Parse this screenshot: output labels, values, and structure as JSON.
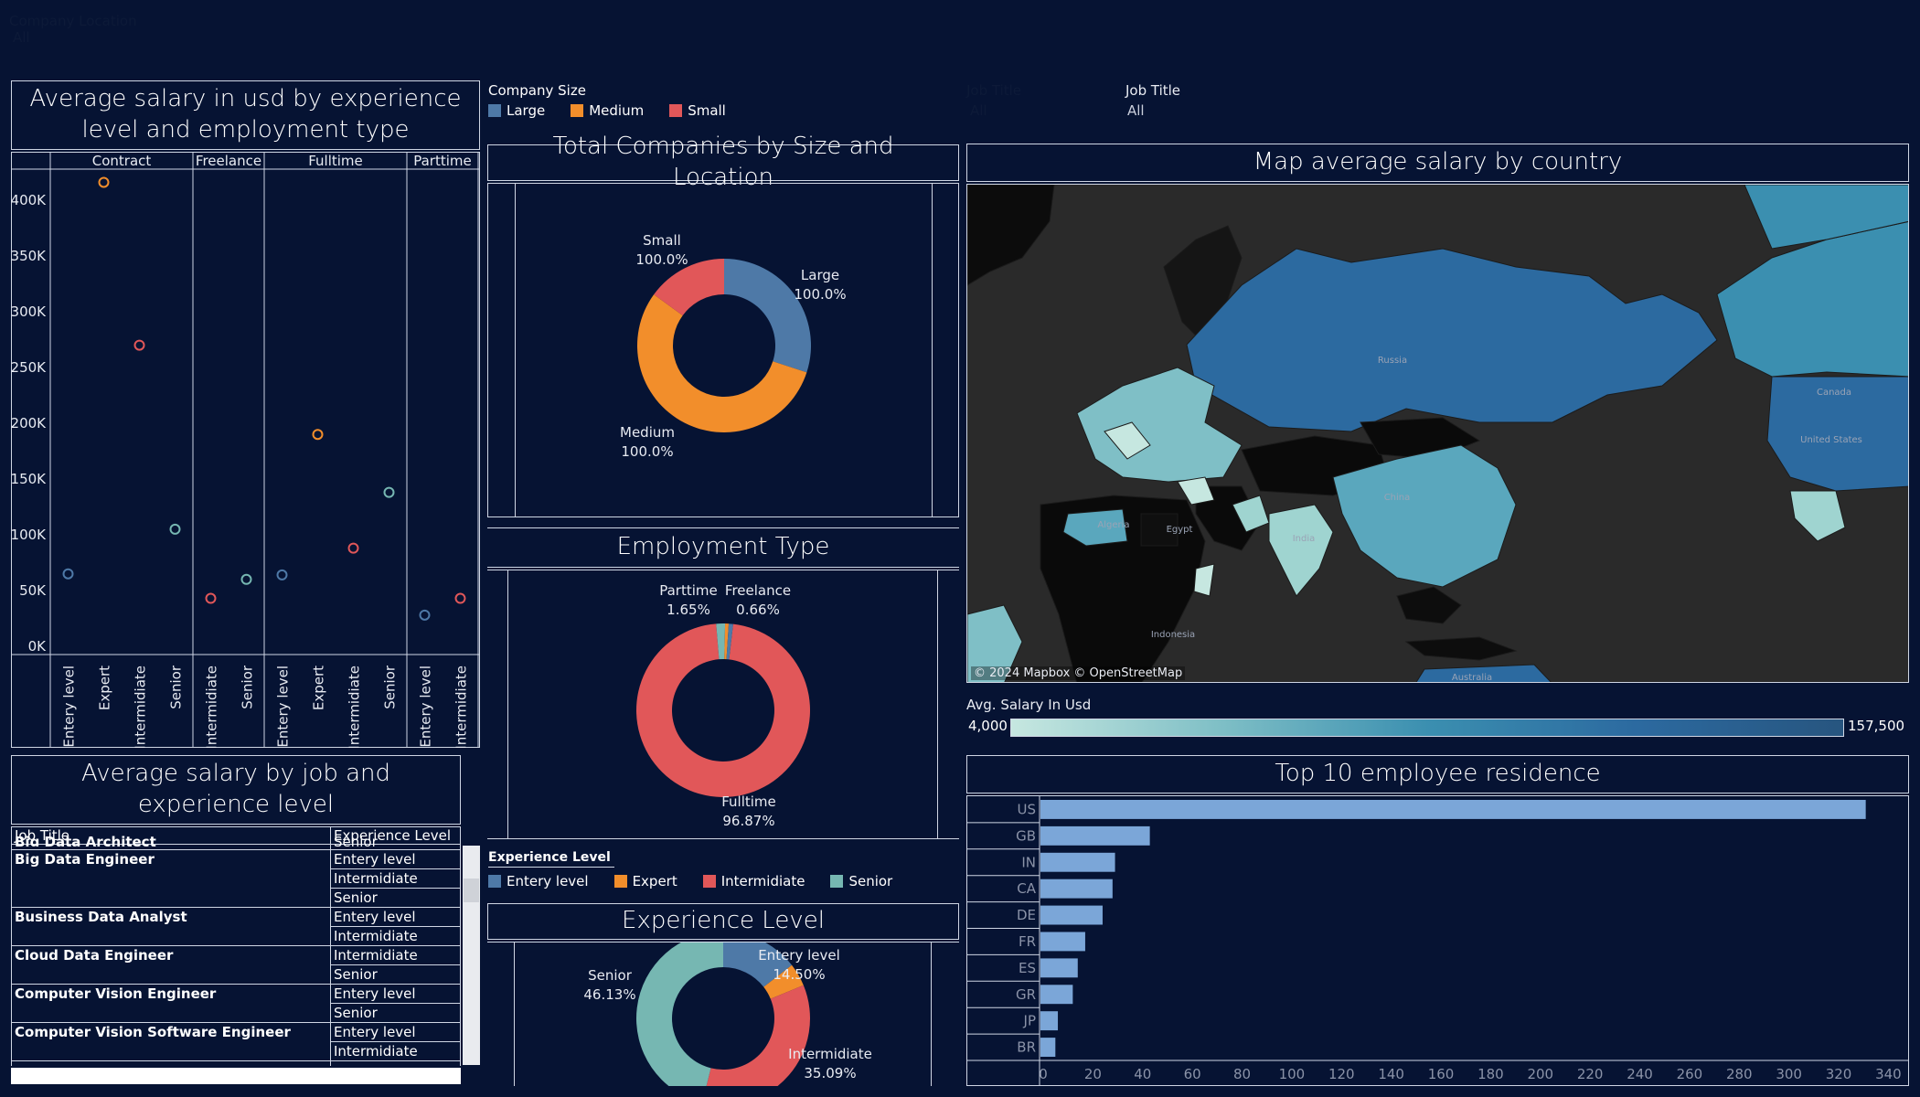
{
  "filters": {
    "company_location": {
      "label": "Company Location",
      "value": "All"
    },
    "company_size_legend": {
      "label": "Company Size",
      "items": [
        {
          "name": "Large",
          "color": "#4e79a7"
        },
        {
          "name": "Medium",
          "color": "#f28e2b"
        },
        {
          "name": "Small",
          "color": "#e15759"
        }
      ]
    },
    "job_title_1": {
      "label": "Job Title",
      "value": "All"
    },
    "job_title_2": {
      "label": "Job Title",
      "value": "All"
    }
  },
  "scatter": {
    "title": "Average salary  in usd by experience level and employment type",
    "groups": [
      "Contract",
      "Freelance",
      "Fulltime",
      "Parttime"
    ],
    "y_ticks": [
      "400K",
      "350K",
      "300K",
      "250K",
      "200K",
      "150K",
      "100K",
      "50K",
      "0K"
    ]
  },
  "chart_data": [
    {
      "type": "scatter",
      "title": "Average salary  in usd by experience level and employment type",
      "ylim": [
        0,
        450000
      ],
      "categories": [
        {
          "group": "Contract",
          "level": "Entery level",
          "value": 65000,
          "color": "#4e79a7"
        },
        {
          "group": "Contract",
          "level": "Expert",
          "value": 416000,
          "color": "#f28e2b"
        },
        {
          "group": "Contract",
          "level": "Intermidiate",
          "value": 270000,
          "color": "#e15759"
        },
        {
          "group": "Contract",
          "level": "Senior",
          "value": 105000,
          "color": "#76b7b2"
        },
        {
          "group": "Freelance",
          "level": "Intermidiate",
          "value": 43000,
          "color": "#e15759"
        },
        {
          "group": "Freelance",
          "level": "Senior",
          "value": 60000,
          "color": "#76b7b2"
        },
        {
          "group": "Fulltime",
          "level": "Entery level",
          "value": 64000,
          "color": "#4e79a7"
        },
        {
          "group": "Fulltime",
          "level": "Expert",
          "value": 190000,
          "color": "#f28e2b"
        },
        {
          "group": "Fulltime",
          "level": "Intermidiate",
          "value": 88000,
          "color": "#e15759"
        },
        {
          "group": "Fulltime",
          "level": "Senior",
          "value": 138000,
          "color": "#76b7b2"
        },
        {
          "group": "Parttime",
          "level": "Entery level",
          "value": 28000,
          "color": "#4e79a7"
        },
        {
          "group": "Parttime",
          "level": "Intermidiate",
          "value": 43000,
          "color": "#e15759"
        }
      ]
    },
    {
      "type": "pie",
      "title": "Total Companies by Size and Location",
      "slices": [
        {
          "name": "Large",
          "value": 30,
          "label": "100.0%",
          "color": "#4e79a7"
        },
        {
          "name": "Medium",
          "value": 55,
          "label": "100.0%",
          "color": "#f28e2b"
        },
        {
          "name": "Small",
          "value": 15,
          "label": "100.0%",
          "color": "#e15759"
        }
      ]
    },
    {
      "type": "pie",
      "title": "Employment Type",
      "slices": [
        {
          "name": "Fulltime",
          "value": 96.87,
          "label": "96.87%",
          "color": "#e15759"
        },
        {
          "name": "Parttime",
          "value": 1.65,
          "label": "1.65%",
          "color": "#76b7b2"
        },
        {
          "name": "Freelance",
          "value": 0.66,
          "label": "0.66%",
          "color": "#f28e2b"
        },
        {
          "name": "Contract",
          "value": 0.82,
          "label": "",
          "color": "#4e79a7"
        }
      ]
    },
    {
      "type": "pie",
      "title": "Experience Level",
      "slices": [
        {
          "name": "Entery level",
          "value": 14.5,
          "label": "14.50%",
          "color": "#4e79a7"
        },
        {
          "name": "Expert",
          "value": 4.28,
          "label": "",
          "color": "#f28e2b"
        },
        {
          "name": "Intermidiate",
          "value": 35.09,
          "label": "35.09%",
          "color": "#e15759"
        },
        {
          "name": "Senior",
          "value": 46.13,
          "label": "46.13%",
          "color": "#76b7b2"
        }
      ]
    },
    {
      "type": "bar",
      "title": "Top 10 employee residence",
      "categories": [
        "US",
        "GB",
        "IN",
        "CA",
        "DE",
        "FR",
        "ES",
        "GR",
        "JP",
        "BR"
      ],
      "values": [
        332,
        44,
        30,
        29,
        25,
        18,
        15,
        13,
        7,
        6
      ],
      "xlim": [
        0,
        345
      ],
      "xticks": [
        "0",
        "20",
        "40",
        "60",
        "80",
        "100",
        "120",
        "140",
        "160",
        "180",
        "200",
        "220",
        "240",
        "260",
        "280",
        "300",
        "320",
        "340"
      ]
    }
  ],
  "donut_titles": {
    "company": "Total Companies by Size and Location",
    "employment": "Employment Type",
    "experience": "Experience Level"
  },
  "donut_labels": {
    "small": {
      "name": "Small",
      "pct": "100.0%"
    },
    "large": {
      "name": "Large",
      "pct": "100.0%"
    },
    "medium": {
      "name": "Medium",
      "pct": "100.0%"
    },
    "parttime": {
      "name": "Parttime",
      "pct": "1.65%"
    },
    "freelance": {
      "name": "Freelance",
      "pct": "0.66%"
    },
    "fulltime": {
      "name": "Fulltime",
      "pct": "96.87%"
    },
    "entry": {
      "name": "Entery level",
      "pct": "14.50%"
    },
    "senior": {
      "name": "Senior",
      "pct": "46.13%"
    },
    "intermediate": {
      "name": "Intermidiate",
      "pct": "35.09%"
    }
  },
  "experience_legend": {
    "label": "Experience Level",
    "items": [
      {
        "name": "Entery level",
        "color": "#4e79a7"
      },
      {
        "name": "Expert",
        "color": "#f28e2b"
      },
      {
        "name": "Intermidiate",
        "color": "#e15759"
      },
      {
        "name": "Senior",
        "color": "#76b7b2"
      }
    ]
  },
  "map": {
    "title": "Map average salary by country",
    "attribution": "© 2024 Mapbox © OpenStreetMap",
    "legend_label": "Avg. Salary In Usd",
    "legend_min": "4,000",
    "legend_max": "157,500",
    "place_labels": [
      "Egypt",
      "Indonesia",
      "Algeria",
      "China",
      "India",
      "Russia",
      "Canada",
      "United States",
      "Australia"
    ]
  },
  "table": {
    "title": "Average salary by job and experience level",
    "headers": [
      "Job Title",
      "Experience Level"
    ],
    "partial_top": {
      "job": "Big Data Architect",
      "level": "Senior"
    },
    "groups": [
      {
        "job": "Big Data Engineer",
        "levels": [
          "Entery level",
          "Intermidiate",
          "Senior"
        ]
      },
      {
        "job": "Business Data Analyst",
        "levels": [
          "Entery level",
          "Intermidiate"
        ]
      },
      {
        "job": "Cloud Data Engineer",
        "levels": [
          "Intermidiate",
          "Senior"
        ]
      },
      {
        "job": "Computer Vision Engineer",
        "levels": [
          "Entery level",
          "Senior"
        ]
      },
      {
        "job": "Computer Vision Software Engineer",
        "levels": [
          "Entery level",
          "Intermidiate"
        ]
      }
    ]
  },
  "bars_title": "Top 10 employee residence"
}
